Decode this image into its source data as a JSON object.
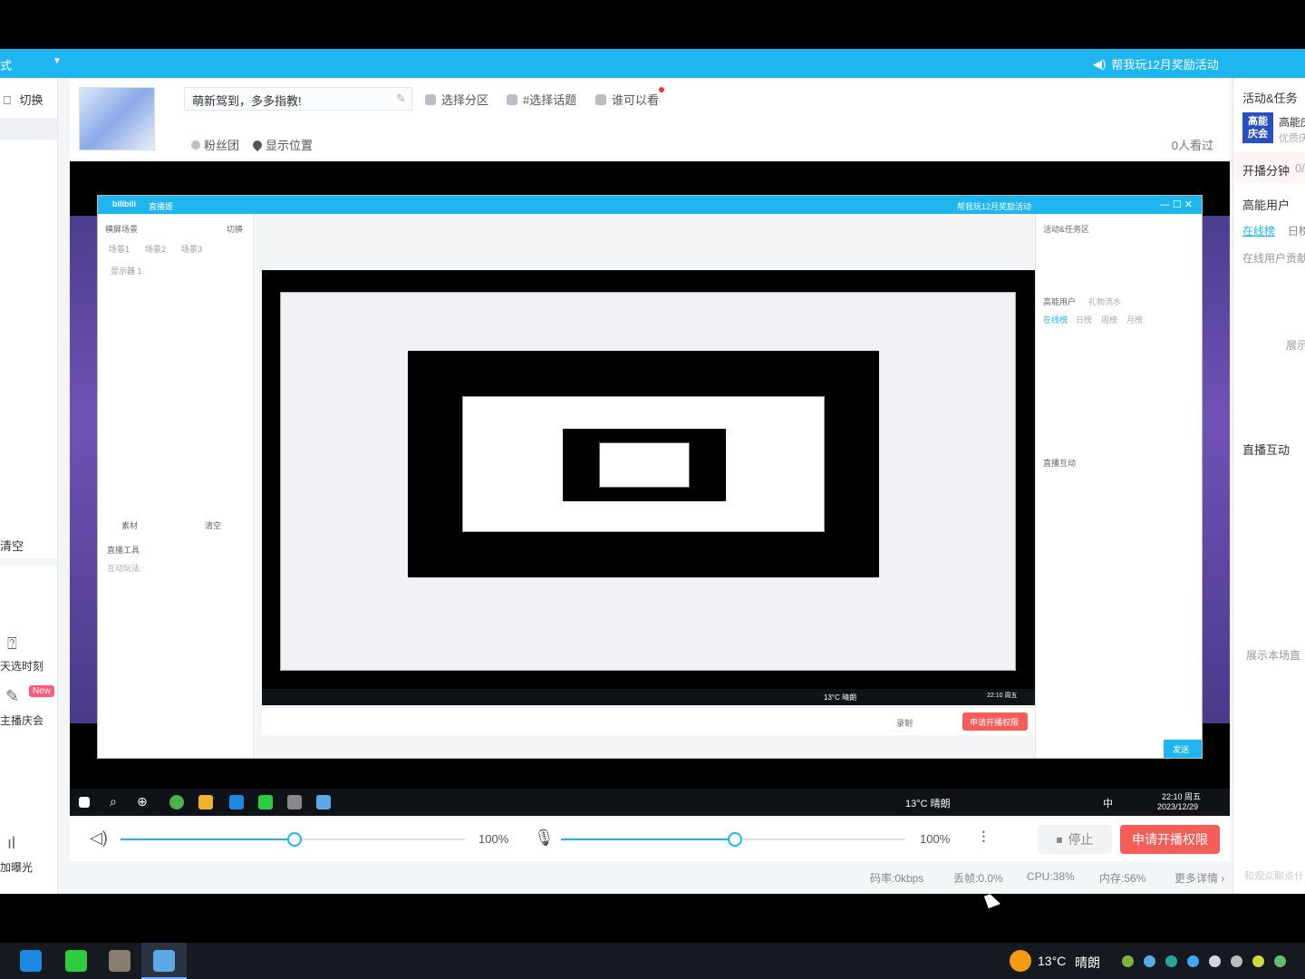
{
  "titlebar": {
    "mode": "式",
    "promo": "帮我玩12月奖励活动"
  },
  "left": {
    "switch": "切换",
    "clear": "清空",
    "timed_pick": "天选时刻",
    "live_celebration": "主播庆会",
    "new_badge": "New",
    "exposure": "加曝光"
  },
  "stream_info": {
    "title": "萌新驾到，多多指教!",
    "category": "选择分区",
    "topic": "#选择话题",
    "who_can_see": "谁可以看",
    "fans_club": "粉丝团",
    "show_location": "显示位置",
    "viewers": "0人看过"
  },
  "nested": {
    "title": "直播姬",
    "promo": "帮我玩12月奖励活动",
    "scene": "横屏场景",
    "switch": "切换",
    "scene1": "场景1",
    "scene2": "场景2",
    "scene3": "场景3",
    "monitor": "显示器 1",
    "material": "素材",
    "clear": "清空",
    "tools": "直播工具",
    "interact": "互动玩法",
    "activities": "活动&任务区",
    "high_energy": "高能用户",
    "gift_flow": "礼物流水",
    "online": "在线榜",
    "daily": "日榜",
    "weekly": "周榜",
    "monthly": "月榜",
    "live_interact": "直播互动",
    "send": "发送",
    "apply": "申请开播权限",
    "record": "录制"
  },
  "taskbar_inner": {
    "weather": "13°C 晴朗",
    "time": "22:10 周五",
    "date": "2023/12/29",
    "lang": "中"
  },
  "controls": {
    "speaker_pct": "100%",
    "mic_pct": "100%",
    "stop": "停止",
    "apply": "申请开播权限"
  },
  "status": {
    "bitrate": "码率:0kbps",
    "drop": "丢帧:0.0%",
    "cpu": "CPU:38%",
    "mem": "内存:56%",
    "more": "更多详情"
  },
  "right": {
    "activities": "活动&任务",
    "high_energy_title": "高能庆",
    "sub": "优质庆",
    "logo_l1": "高能",
    "logo_l2": "庆会",
    "minutes": "开播分钟",
    "minutes_val": "0/",
    "high_energy_users": "高能用户",
    "online": "在线榜",
    "daily": "日榜",
    "contrib": "在线用户贡献",
    "show": "展示",
    "live_interact": "直播互动",
    "show_scene": "展示本场直",
    "input_ph": "和观众聊点什"
  },
  "os_taskbar": {
    "weather": "13°C",
    "weather_desc": "晴朗"
  }
}
